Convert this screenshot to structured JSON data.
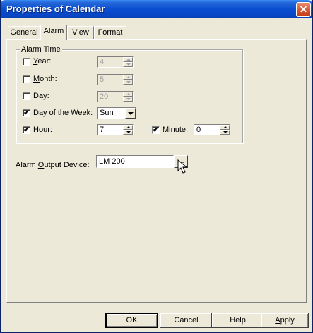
{
  "window": {
    "title": "Properties of Calendar",
    "close_glyph": "✕"
  },
  "tabs": [
    {
      "label": "General",
      "active": false
    },
    {
      "label": "Alarm",
      "active": true
    },
    {
      "label": "View",
      "active": false
    },
    {
      "label": "Format",
      "active": false
    }
  ],
  "alarm_time": {
    "group_label": "Alarm Time",
    "year": {
      "label_pre": "",
      "label_u": "Y",
      "label_post": "ear:",
      "checked": false,
      "value": "4",
      "disabled": true
    },
    "month": {
      "label_pre": "",
      "label_u": "M",
      "label_post": "onth:",
      "checked": false,
      "value": "5",
      "disabled": true
    },
    "day": {
      "label_pre": "",
      "label_u": "D",
      "label_post": "ay:",
      "checked": false,
      "value": "20",
      "disabled": true
    },
    "day_of_week": {
      "label_pre": "Day of the ",
      "label_u": "W",
      "label_post": "eek:",
      "checked": true,
      "value": "Sun"
    },
    "hour": {
      "label_pre": "",
      "label_u": "H",
      "label_post": "our:",
      "checked": true,
      "value": "7"
    },
    "minute": {
      "label_pre": "Mi",
      "label_u": "n",
      "label_post": "ute:",
      "checked": true,
      "value": "0"
    }
  },
  "output_device": {
    "label_pre": "Alarm ",
    "label_u": "O",
    "label_post": "utput Device:",
    "value": "LM 200",
    "browse_glyph": "..."
  },
  "buttons": {
    "ok": "OK",
    "cancel": "Cancel",
    "help": "Help",
    "apply_u": "A",
    "apply_post": "pply"
  },
  "icons": {
    "check_glyph": "✔",
    "cursor": "mouse-pointer-icon"
  },
  "colors": {
    "title_bar": "#0a4fd0",
    "dialog_bg": "#ece9d8",
    "close_button": "#d5522e"
  }
}
